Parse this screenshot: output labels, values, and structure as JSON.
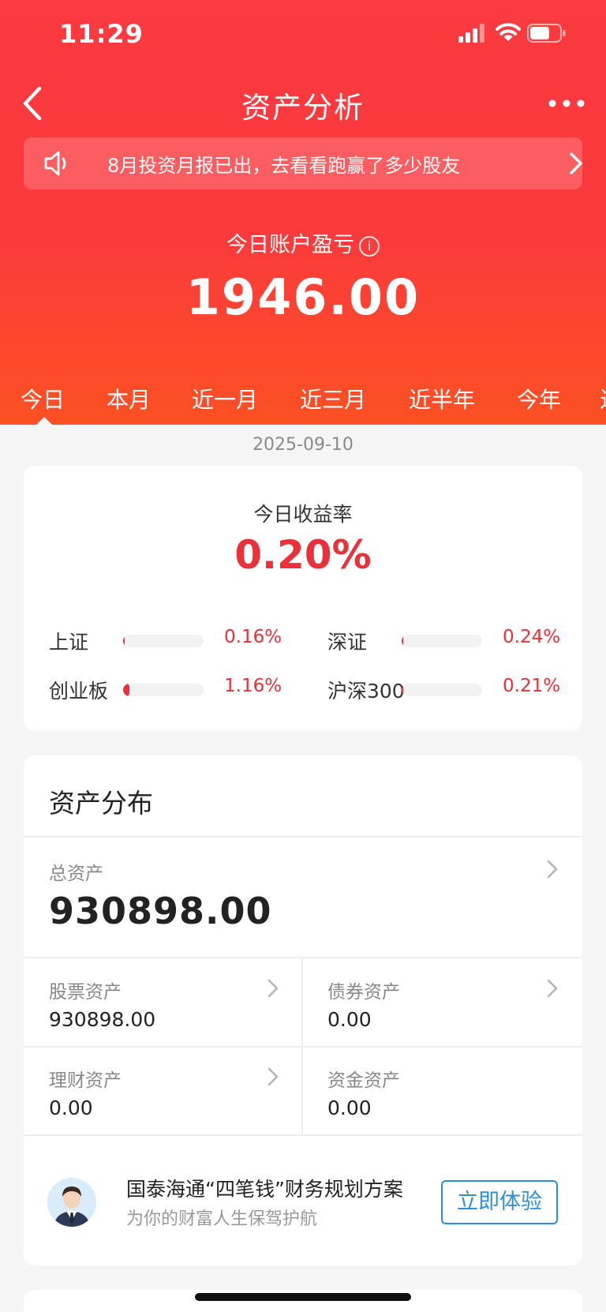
{
  "status": {
    "time": "11:29"
  },
  "nav": {
    "title": "资产分析"
  },
  "notice": {
    "text": "8月投资月报已出，去看看跑赢了多少股友"
  },
  "today_pl": {
    "label": "今日账户盈亏",
    "info": "i",
    "value": "1946.00"
  },
  "tabs": [
    "今日",
    "本月",
    "近一月",
    "近三月",
    "近半年",
    "今年",
    "近"
  ],
  "date": "2025-09-10",
  "return_card": {
    "label": "今日收益率",
    "value": "0.20%",
    "indices": [
      {
        "name": "上证",
        "pct": "0.16%",
        "level": 0.01
      },
      {
        "name": "深证",
        "pct": "0.24%",
        "level": 0.01
      },
      {
        "name": "创业板",
        "pct": "1.16%",
        "level": 0.08
      },
      {
        "name": "沪深300",
        "pct": "0.21%",
        "level": 0.01
      }
    ]
  },
  "assets": {
    "title": "资产分布",
    "total_label": "总资产",
    "total_value": "930898.00",
    "cells": [
      {
        "label": "股票资产",
        "value": "930898.00"
      },
      {
        "label": "债券资产",
        "value": "0.00"
      },
      {
        "label": "理财资产",
        "value": "0.00"
      },
      {
        "label": "资金资产",
        "value": "0.00"
      }
    ],
    "promo": {
      "title": "国泰海通“四笔钱”财务规划方案",
      "subtitle": "为你的财富人生保驾护航",
      "button": "立即体验"
    }
  },
  "colors": {
    "brand_red": "#fb3a41",
    "gain_red": "#e8313b",
    "link_blue": "#2b8fd9"
  }
}
